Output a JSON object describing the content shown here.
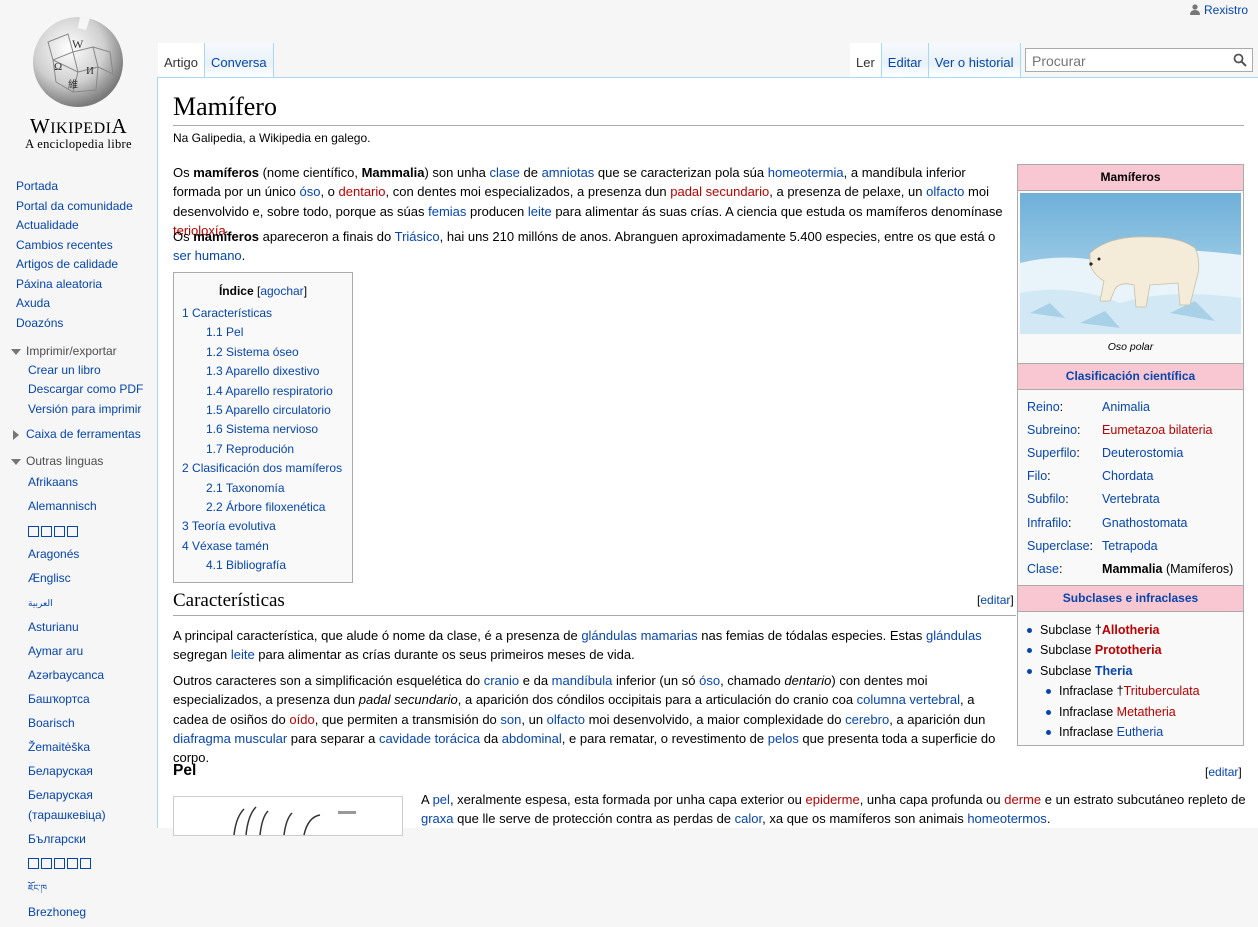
{
  "logo": {
    "wordmark": "Wikipedia",
    "tagline": "A enciclopedia libre"
  },
  "personal": {
    "register": "Rexistro"
  },
  "tabs": {
    "article": "Artigo",
    "talk": "Conversa",
    "read": "Ler",
    "edit": "Editar",
    "history": "Ver o historial"
  },
  "search": {
    "placeholder": "Procurar"
  },
  "sidebar": {
    "nav": [
      "Portada",
      "Portal da comunidade",
      "Actualidade",
      "Cambios recentes",
      "Artigos de calidade",
      "Páxina aleatoria",
      "Axuda",
      "Doazóns"
    ],
    "print_export": {
      "title": "Imprimir/exportar",
      "items": [
        "Crear un libro",
        "Descargar como PDF",
        "Versión para imprimir"
      ]
    },
    "toolbox": {
      "title": "Caixa de ferramentas"
    },
    "languages": {
      "title": "Outras linguas",
      "items": [
        "Afrikaans",
        "Alemannisch",
        "",
        "Aragonés",
        "Ænglisc",
        "العربية",
        "Asturianu",
        "Aymar aru",
        "Azərbaycanca",
        "Башҡортса",
        "Boarisch",
        "Žemaitėška",
        "Беларуская",
        "Беларуская (тарашкевіца)",
        "Български",
        "",
        "ཇོང་ཁ",
        "Brezhoneg"
      ]
    }
  },
  "article": {
    "title": "Mamífero",
    "sitesub": "Na Galipedia, a Wikipedia en galego.",
    "toc": {
      "title": "Índice",
      "toggle": "agochar",
      "entries": [
        {
          "num": "1",
          "text": "Características",
          "level": 1
        },
        {
          "num": "1.1",
          "text": "Pel",
          "level": 2
        },
        {
          "num": "1.2",
          "text": "Sistema óseo",
          "level": 2
        },
        {
          "num": "1.3",
          "text": "Aparello dixestivo",
          "level": 2
        },
        {
          "num": "1.4",
          "text": "Aparello respiratorio",
          "level": 2
        },
        {
          "num": "1.5",
          "text": "Aparello circulatorio",
          "level": 2
        },
        {
          "num": "1.6",
          "text": "Sistema nervioso",
          "level": 2
        },
        {
          "num": "1.7",
          "text": "Reprodución",
          "level": 2
        },
        {
          "num": "2",
          "text": "Clasificación dos mamíferos",
          "level": 1
        },
        {
          "num": "2.1",
          "text": "Taxonomía",
          "level": 2
        },
        {
          "num": "2.2",
          "text": "Árbore filoxenética",
          "level": 2
        },
        {
          "num": "3",
          "text": "Teoría evolutiva",
          "level": 1
        },
        {
          "num": "4",
          "text": "Véxase tamén",
          "level": 1
        },
        {
          "num": "4.1",
          "text": "Bibliografía",
          "level": 2
        }
      ]
    },
    "section1": {
      "title": "Características",
      "edit": "editar"
    },
    "section2": {
      "title": "Pel",
      "edit": "editar"
    }
  },
  "infobox": {
    "title": "Mamíferos",
    "caption": "Oso polar",
    "classification_title": "Clasificación científica",
    "rows": [
      {
        "rank": "Reino",
        "value": "Animalia",
        "link": "blue"
      },
      {
        "rank": "Subreino",
        "value": "Eumetazoa bilateria",
        "link": "red"
      },
      {
        "rank": "Superfilo",
        "value": "Deuterostomia",
        "link": "blue"
      },
      {
        "rank": "Filo",
        "value": "Chordata",
        "link": "blue"
      },
      {
        "rank": "Subfilo",
        "value": "Vertebrata",
        "link": "blue"
      },
      {
        "rank": "Infrafilo",
        "value": "Gnathostomata",
        "link": "blue"
      },
      {
        "rank": "Superclase",
        "value": "Tetrapoda",
        "link": "blue"
      },
      {
        "rank": "Clase",
        "value": "Mammalia",
        "link": "bold",
        "extra": "(Mamíferos)"
      }
    ],
    "subclasses_title": "Subclases e infraclases",
    "subclasses": [
      {
        "prefix": "Subclase ",
        "dagger": "†",
        "name": "Allotheria",
        "color": "red",
        "indent": 0
      },
      {
        "prefix": "Subclase ",
        "dagger": "",
        "name": "Prototheria",
        "color": "red",
        "indent": 0
      },
      {
        "prefix": "Subclase ",
        "dagger": "",
        "name": "Theria",
        "color": "blue",
        "indent": 0
      },
      {
        "prefix": "Infraclase ",
        "dagger": "†",
        "name": "Trituberculata",
        "color": "red-plain",
        "indent": 1
      },
      {
        "prefix": "Infraclase ",
        "dagger": "",
        "name": "Metatheria",
        "color": "red-plain",
        "indent": 1
      },
      {
        "prefix": "Infraclase ",
        "dagger": "",
        "name": "Eutheria",
        "color": "blue-plain",
        "indent": 1
      }
    ]
  },
  "colors": {
    "link": "#0645ad",
    "redlink": "#ba0000",
    "infobox_header": "#f9c7d1",
    "border": "#a7d7f9"
  }
}
